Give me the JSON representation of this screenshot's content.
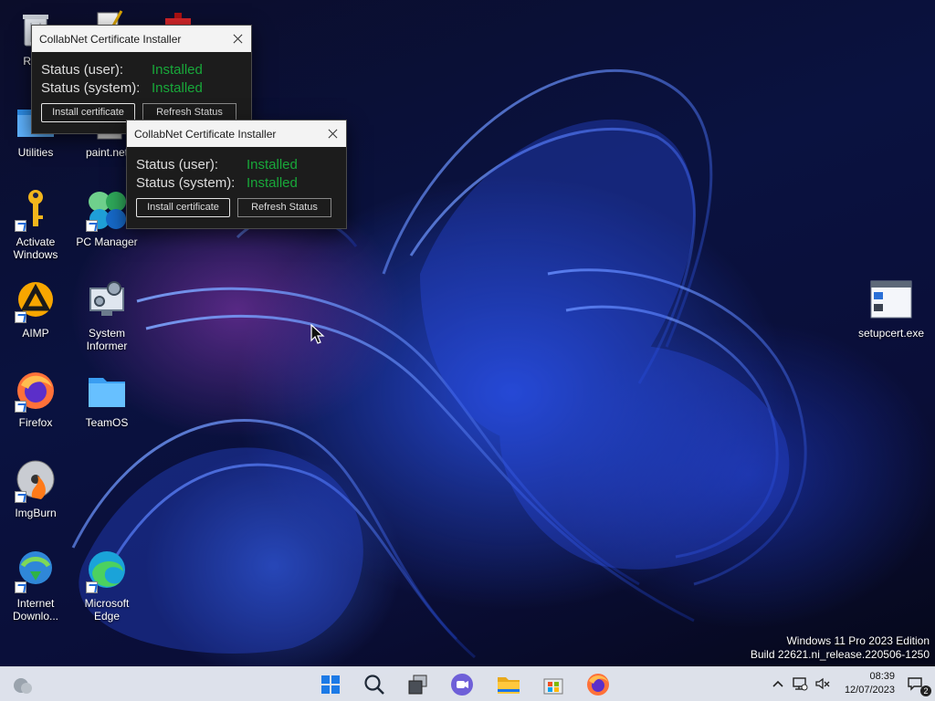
{
  "desktop": {
    "icons": [
      {
        "label": "Recy",
        "icon": "recycle-bin-icon"
      },
      {
        "label": "",
        "icon": "notepad-icon"
      },
      {
        "label": "",
        "icon": "toolbox-icon"
      },
      {
        "label": "Utilities",
        "icon": "folder-icon"
      },
      {
        "label": "paint.net",
        "icon": "paint-net-icon"
      },
      {
        "label": "Activate Windows",
        "icon": "key-icon"
      },
      {
        "label": "PC Manager",
        "icon": "pc-manager-icon"
      },
      {
        "label": "AIMP",
        "icon": "aimp-icon"
      },
      {
        "label": "System Informer",
        "icon": "system-informer-icon"
      },
      {
        "label": "Firefox",
        "icon": "firefox-icon"
      },
      {
        "label": "TeamOS",
        "icon": "folder-icon"
      },
      {
        "label": "ImgBurn",
        "icon": "imgburn-icon"
      },
      {
        "label": "Internet Downlo...",
        "icon": "internet-download-manager-icon"
      },
      {
        "label": "Microsoft Edge",
        "icon": "edge-icon"
      },
      {
        "label": "setupcert.exe",
        "icon": "executable-icon"
      }
    ]
  },
  "dialogs": [
    {
      "title": "CollabNet Certificate Installer",
      "status_user_label": "Status (user):",
      "status_user_value": "Installed",
      "status_system_label": "Status (system):",
      "status_system_value": "Installed",
      "install_button": "Install certificate",
      "refresh_button": "Refresh Status"
    },
    {
      "title": "CollabNet Certificate Installer",
      "status_user_label": "Status (user):",
      "status_user_value": "Installed",
      "status_system_label": "Status (system):",
      "status_system_value": "Installed",
      "install_button": "Install certificate",
      "refresh_button": "Refresh Status"
    }
  ],
  "watermark": {
    "edition": "Windows 11 Pro 2023 Edition",
    "build": "Build 22621.ni_release.220506-1250"
  },
  "taskbar": {
    "apps": [
      "weather-icon",
      "start-icon",
      "search-icon",
      "task-view-icon",
      "meet-icon",
      "file-explorer-icon",
      "store-icon",
      "firefox-icon"
    ],
    "clock_time": "08:39",
    "clock_date": "12/07/2023",
    "notification_count": "2"
  },
  "colors": {
    "status_installed": "#18a83a",
    "dialog_bg": "#1c1c1c",
    "taskbar_bg": "#e6eaf2"
  }
}
